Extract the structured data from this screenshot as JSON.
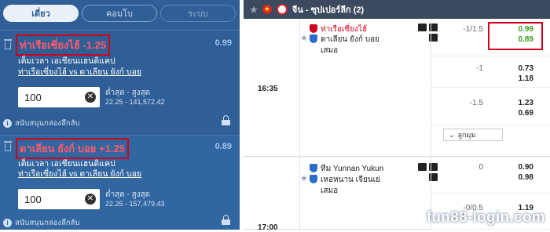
{
  "tabs": [
    {
      "label": "เดี่ยว",
      "state": "active"
    },
    {
      "label": "คอมโบ",
      "state": "normal"
    },
    {
      "label": "ระบบ",
      "state": "muted"
    }
  ],
  "bets": [
    {
      "selection": "ท่าเรือเซี่ยงไฮ้ -1.25",
      "odds": "0.99",
      "market": "เต็มเวลา เอเชียนแฮนดิแคป",
      "match": "ท่าเรือเซี่ยงไฮ้ vs ดาเลียน ยังก์ บอย",
      "stake": "100",
      "limits_label": "ต่ำสุด - สูงสุด",
      "limits": "22.25 - 141,572.42",
      "accept_label": "สนับสนุนกล่องลึกลับ"
    },
    {
      "selection": "ดาเลียน ยังก์ บอย +1.25",
      "odds": "0.89",
      "market": "เต็มเวลา เอเชียนแฮนดิแคป",
      "match": "ท่าเรือเซี่ยงไฮ้ vs ดาเลียน ยังก์ บอย",
      "stake": "100",
      "limits_label": "ต่ำสุด - สูงสุด",
      "limits": "22.25 - 157,479.43",
      "accept_label": "สนับสนุนกล่องลึกลับ"
    }
  ],
  "league": {
    "name": "จีน - ซุปเปอร์ลีก (2)"
  },
  "matches": [
    {
      "time": "16:35",
      "home": "ท่าเรือเซี่ยงไฮ้",
      "away": "ดาเลียน ยังก์ บอย",
      "draw": "เสมอ",
      "lines": [
        {
          "hdp": "-1/1.5",
          "home_price": "0.99",
          "away_price": "0.89"
        },
        {
          "hdp": "-1",
          "home_price": "0.73",
          "away_price": "1.18"
        },
        {
          "hdp": "-1.5",
          "home_price": "1.23",
          "away_price": "0.69"
        }
      ],
      "more_label": "ลูกมุม"
    },
    {
      "time": "17:00",
      "home": "ทีม Yunnan Yukun",
      "away": "เหอหนาน เจียนเย่",
      "draw": "เสมอ",
      "lines": [
        {
          "hdp": "0",
          "home_price": "0.90",
          "away_price": "0.98"
        },
        {
          "hdp": "-0/0.5",
          "home_price": "1.19",
          "away_price": ""
        }
      ]
    }
  ],
  "watermark": "fun88-login.com",
  "colors": {
    "panel": "#2f5f96",
    "highlight": "#d0021b",
    "price_green": "#3a9a1a"
  }
}
